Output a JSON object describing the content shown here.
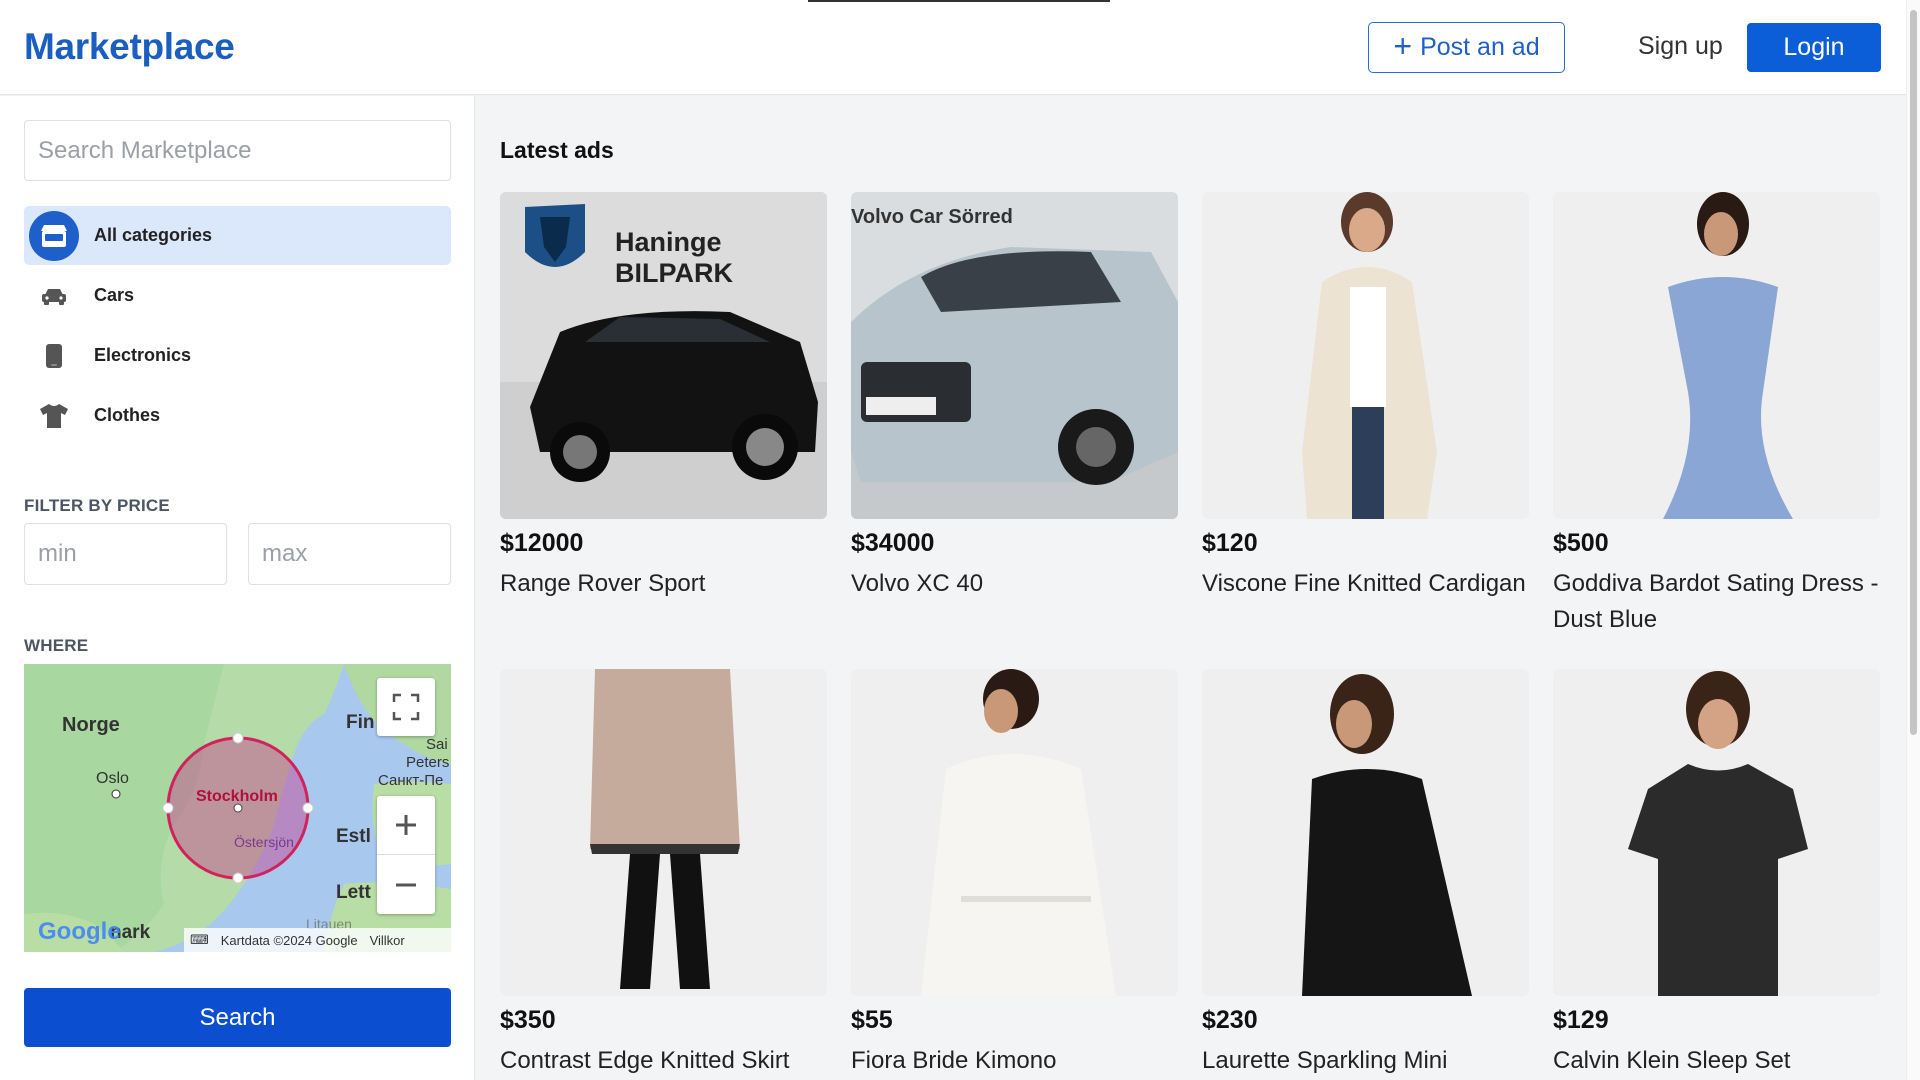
{
  "header": {
    "logo": "Marketplace",
    "post_ad_label": "Post an ad",
    "signup_label": "Sign up",
    "login_label": "Login"
  },
  "sidebar": {
    "search_placeholder": "Search Marketplace",
    "categories": [
      {
        "label": "All categories",
        "icon": "store-icon",
        "active": true
      },
      {
        "label": "Cars",
        "icon": "car-icon",
        "active": false
      },
      {
        "label": "Electronics",
        "icon": "phone-icon",
        "active": false
      },
      {
        "label": "Clothes",
        "icon": "tshirt-icon",
        "active": false
      }
    ],
    "filter_label": "FILTER BY PRICE",
    "min_placeholder": "min",
    "max_placeholder": "max",
    "where_label": "WHERE",
    "map": {
      "labels": [
        "Norge",
        "Oslo",
        "Stockholm",
        "Östersjön",
        "Fin",
        "Sai",
        "Peters",
        "Санкт-Пе",
        "Estl",
        "Lett",
        "nark",
        "Litauen"
      ],
      "attribution": "Kartdata ©2024 Google",
      "terms": "Villkor",
      "brand": "Google"
    },
    "search_label": "Search"
  },
  "main": {
    "title": "Latest ads",
    "ads": [
      {
        "price": "$12000",
        "title": "Range Rover Sport",
        "image": "black-suv-photo",
        "overlay_text": "Haninge BILPARK"
      },
      {
        "price": "$34000",
        "title": "Volvo XC 40",
        "image": "silver-suv-photo",
        "overlay_text": "Volvo Car Sörred"
      },
      {
        "price": "$120",
        "title": "Viscone Fine Knitted Cardigan",
        "image": "cardigan-photo"
      },
      {
        "price": "$500",
        "title": "Goddiva Bardot Sating Dress - Dust Blue",
        "image": "blue-dress-photo"
      },
      {
        "price": "$350",
        "title": "Contrast Edge Knitted Skirt",
        "image": "knitted-skirt-photo"
      },
      {
        "price": "$55",
        "title": "Fiora Bride Kimono",
        "image": "white-kimono-photo"
      },
      {
        "price": "$230",
        "title": "Laurette Sparkling Mini",
        "image": "black-dress-photo"
      },
      {
        "price": "$129",
        "title": "Calvin Klein Sleep Set",
        "image": "black-tshirt-photo"
      }
    ]
  },
  "colors": {
    "brand": "#1a5fc0",
    "primary_button": "#0b5ed7",
    "active_category_bg": "#dbe7fb"
  }
}
